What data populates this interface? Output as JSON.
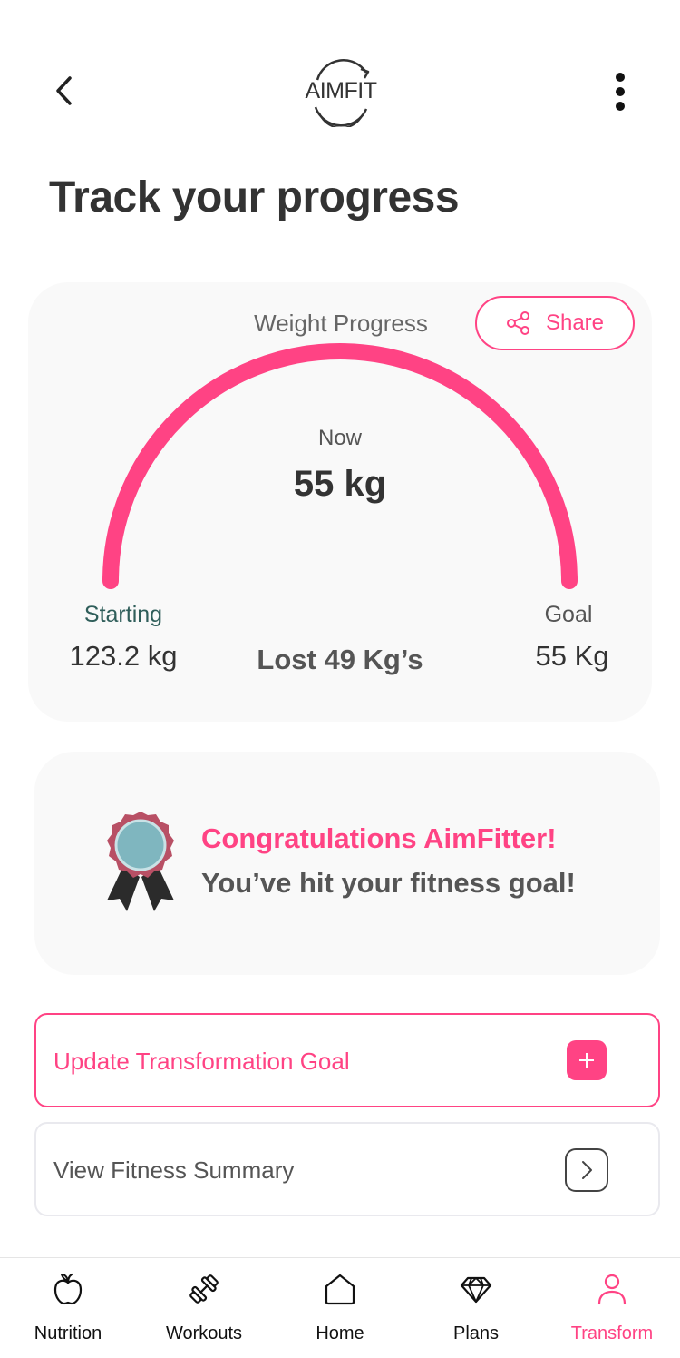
{
  "header": {
    "logo_text": "AIMFIT"
  },
  "page_title": "Track your progress",
  "weight_card": {
    "title": "Weight Progress",
    "share_label": "Share",
    "now_label": "Now",
    "now_value": "55 kg",
    "starting_label": "Starting",
    "starting_value": "123.2 kg",
    "lost_value": "Lost 49 Kg’s",
    "goal_label": "Goal",
    "goal_value": "55 Kg",
    "progress": 1.0
  },
  "congrats": {
    "title": "Congratulations AimFitter!",
    "subtitle": "You’ve hit your fitness goal!"
  },
  "actions": {
    "update_label": "Update Transformation Goal",
    "summary_label": "View Fitness Summary"
  },
  "bottom_nav": {
    "items": [
      {
        "label": "Nutrition",
        "icon": "apple-icon"
      },
      {
        "label": "Workouts",
        "icon": "dumbbell-icon"
      },
      {
        "label": "Home",
        "icon": "home-icon"
      },
      {
        "label": "Plans",
        "icon": "diamond-icon"
      },
      {
        "label": "Transform",
        "icon": "person-icon"
      }
    ],
    "active": "Transform"
  },
  "colors": {
    "accent": "#ff4384",
    "card_bg": "#f9f9f9",
    "text_dark": "#333333",
    "starting_label": "#2f5e5a"
  }
}
